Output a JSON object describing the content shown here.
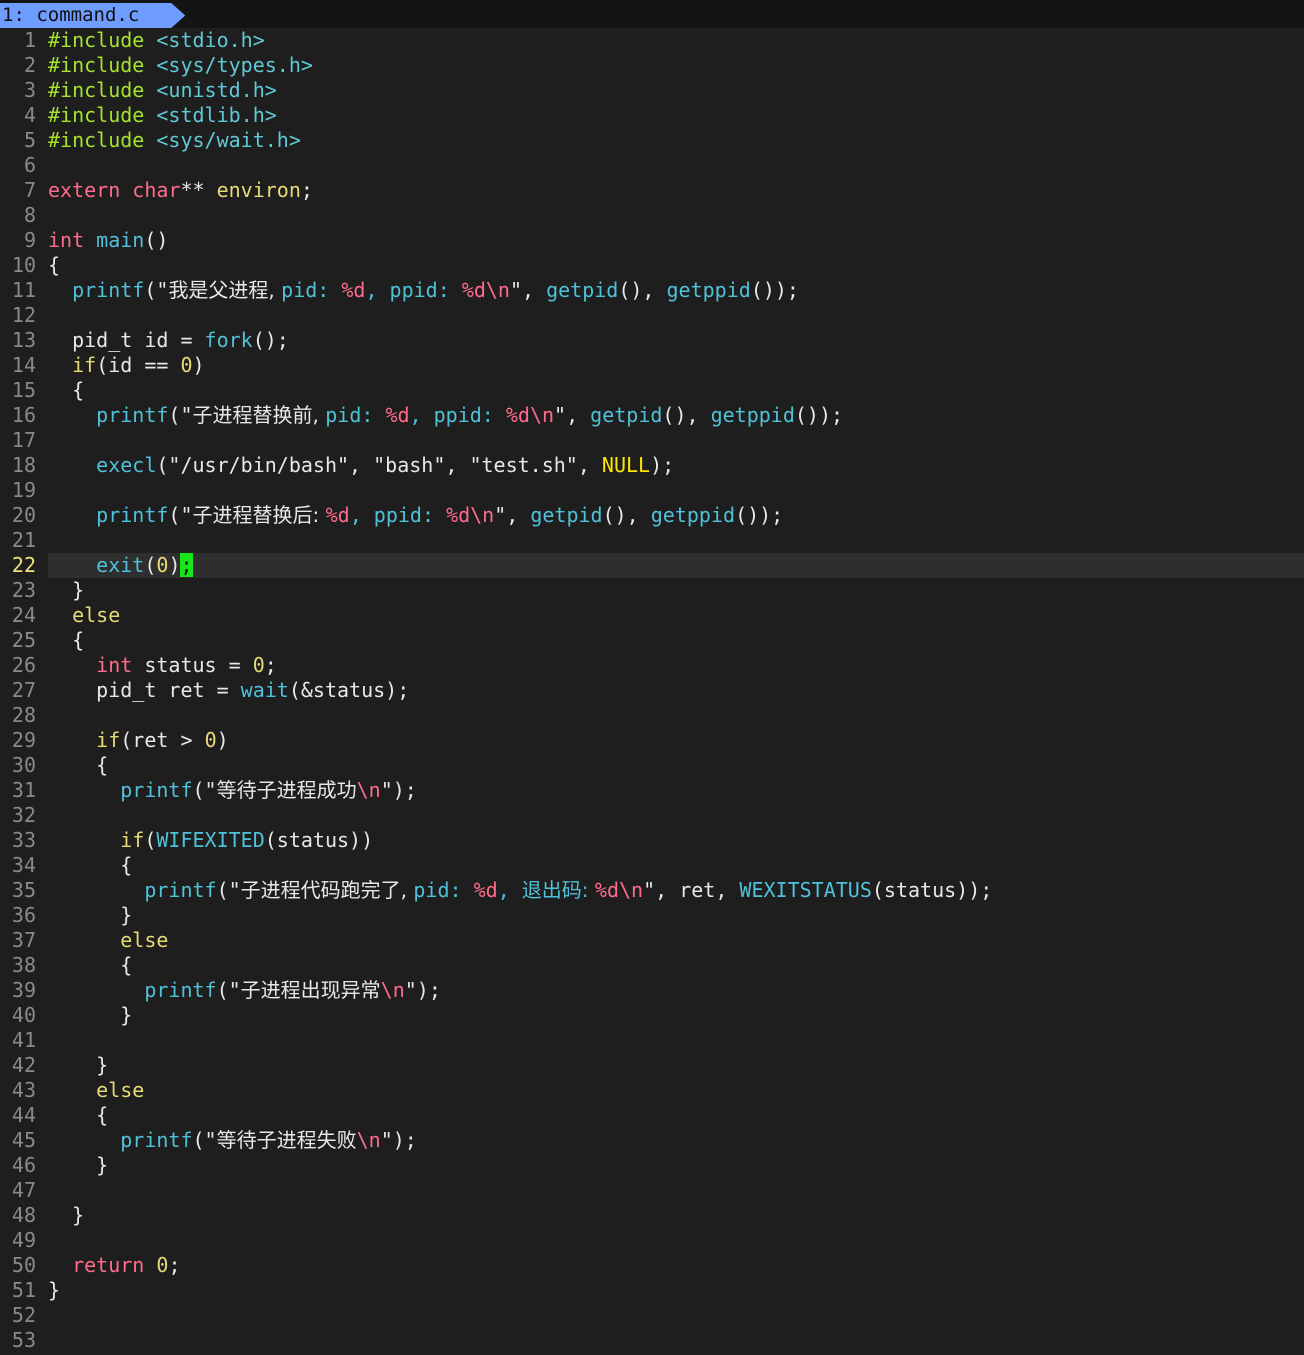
{
  "tabline": {
    "tab_label": "1: command.c"
  },
  "colors": {
    "background": "#1e1e1e",
    "tab": "#6e9dff",
    "keyword_type": "#ff6b8a",
    "keyword_control": "#e6db74",
    "function": "#4fc1d9",
    "preprocessor": "#a6e22e",
    "cursor": "#19e619"
  },
  "editor": {
    "current_line": 22,
    "lines": [
      {
        "n": "1",
        "tokens": [
          [
            "k-pre",
            "#include "
          ],
          [
            "k-inc",
            "<stdio.h>"
          ]
        ]
      },
      {
        "n": "2",
        "tokens": [
          [
            "k-pre",
            "#include "
          ],
          [
            "k-inc",
            "<sys/types.h>"
          ]
        ]
      },
      {
        "n": "3",
        "tokens": [
          [
            "k-pre",
            "#include "
          ],
          [
            "k-inc",
            "<unistd.h>"
          ]
        ]
      },
      {
        "n": "4",
        "tokens": [
          [
            "k-pre",
            "#include "
          ],
          [
            "k-inc",
            "<stdlib.h>"
          ]
        ]
      },
      {
        "n": "5",
        "tokens": [
          [
            "k-pre",
            "#include "
          ],
          [
            "k-inc",
            "<sys/wait.h>"
          ]
        ]
      },
      {
        "n": "6",
        "tokens": []
      },
      {
        "n": "7",
        "tokens": [
          [
            "k-type",
            "extern "
          ],
          [
            "k-type",
            "char"
          ],
          [
            "k-plain",
            "** "
          ],
          [
            "k-ctrl",
            "environ"
          ],
          [
            "k-plain",
            ";"
          ]
        ]
      },
      {
        "n": "8",
        "tokens": []
      },
      {
        "n": "9",
        "tokens": [
          [
            "k-type",
            "int "
          ],
          [
            "k-fn",
            "main"
          ],
          [
            "k-plain",
            "()"
          ]
        ]
      },
      {
        "n": "10",
        "tokens": [
          [
            "k-plain",
            "{"
          ]
        ]
      },
      {
        "n": "11",
        "tokens": [
          [
            "k-plain",
            "  "
          ],
          [
            "k-fn",
            "printf"
          ],
          [
            "k-plain",
            "(\""
          ],
          [
            "k-str k-cjk",
            "我是父进程, "
          ],
          [
            "k-fn",
            "pid: "
          ],
          [
            "k-esc",
            "%d"
          ],
          [
            "k-fn",
            ", ppid: "
          ],
          [
            "k-esc",
            "%d\\n"
          ],
          [
            "k-plain",
            "\", "
          ],
          [
            "k-fn",
            "getpid"
          ],
          [
            "k-plain",
            "(), "
          ],
          [
            "k-fn",
            "getppid"
          ],
          [
            "k-plain",
            "());"
          ]
        ]
      },
      {
        "n": "12",
        "tokens": []
      },
      {
        "n": "13",
        "tokens": [
          [
            "k-plain",
            "  pid_t id = "
          ],
          [
            "k-fn",
            "fork"
          ],
          [
            "k-plain",
            "();"
          ]
        ]
      },
      {
        "n": "14",
        "tokens": [
          [
            "k-plain",
            "  "
          ],
          [
            "k-ctrl",
            "if"
          ],
          [
            "k-plain",
            "(id == "
          ],
          [
            "k-num",
            "0"
          ],
          [
            "k-plain",
            ")"
          ]
        ]
      },
      {
        "n": "15",
        "tokens": [
          [
            "k-plain",
            "  {"
          ]
        ]
      },
      {
        "n": "16",
        "tokens": [
          [
            "k-plain",
            "    "
          ],
          [
            "k-fn",
            "printf"
          ],
          [
            "k-plain",
            "(\""
          ],
          [
            "k-str k-cjk",
            "子进程替换前, "
          ],
          [
            "k-fn",
            "pid: "
          ],
          [
            "k-esc",
            "%d"
          ],
          [
            "k-fn",
            ", ppid: "
          ],
          [
            "k-esc",
            "%d\\n"
          ],
          [
            "k-plain",
            "\", "
          ],
          [
            "k-fn",
            "getpid"
          ],
          [
            "k-plain",
            "(), "
          ],
          [
            "k-fn",
            "getppid"
          ],
          [
            "k-plain",
            "());"
          ]
        ]
      },
      {
        "n": "17",
        "tokens": []
      },
      {
        "n": "18",
        "tokens": [
          [
            "k-plain",
            "    "
          ],
          [
            "k-fn",
            "execl"
          ],
          [
            "k-plain",
            "(\"/usr/bin/bash\", \"bash\", \"test.sh\", "
          ],
          [
            "k-const",
            "NULL"
          ],
          [
            "k-plain",
            ");"
          ]
        ]
      },
      {
        "n": "19",
        "tokens": []
      },
      {
        "n": "20",
        "tokens": [
          [
            "k-plain",
            "    "
          ],
          [
            "k-fn",
            "printf"
          ],
          [
            "k-plain",
            "(\""
          ],
          [
            "k-str k-cjk",
            "子进程替换后: "
          ],
          [
            "k-esc",
            "%d"
          ],
          [
            "k-fn",
            ", ppid: "
          ],
          [
            "k-esc",
            "%d\\n"
          ],
          [
            "k-plain",
            "\", "
          ],
          [
            "k-fn",
            "getpid"
          ],
          [
            "k-plain",
            "(), "
          ],
          [
            "k-fn",
            "getppid"
          ],
          [
            "k-plain",
            "());"
          ]
        ]
      },
      {
        "n": "21",
        "tokens": []
      },
      {
        "n": "22",
        "tokens": [
          [
            "k-plain",
            "    "
          ],
          [
            "k-fn",
            "exit"
          ],
          [
            "k-plain",
            "("
          ],
          [
            "k-num",
            "0"
          ],
          [
            "k-plain",
            ")"
          ],
          [
            "cursor",
            ";"
          ]
        ]
      },
      {
        "n": "23",
        "tokens": [
          [
            "k-plain",
            "  }"
          ]
        ]
      },
      {
        "n": "24",
        "tokens": [
          [
            "k-plain",
            "  "
          ],
          [
            "k-ctrl",
            "else"
          ]
        ]
      },
      {
        "n": "25",
        "tokens": [
          [
            "k-plain",
            "  {"
          ]
        ]
      },
      {
        "n": "26",
        "tokens": [
          [
            "k-plain",
            "    "
          ],
          [
            "k-type",
            "int "
          ],
          [
            "k-plain",
            "status = "
          ],
          [
            "k-num",
            "0"
          ],
          [
            "k-plain",
            ";"
          ]
        ]
      },
      {
        "n": "27",
        "tokens": [
          [
            "k-plain",
            "    pid_t ret = "
          ],
          [
            "k-fn",
            "wait"
          ],
          [
            "k-plain",
            "(&status);"
          ]
        ]
      },
      {
        "n": "28",
        "tokens": []
      },
      {
        "n": "29",
        "tokens": [
          [
            "k-plain",
            "    "
          ],
          [
            "k-ctrl",
            "if"
          ],
          [
            "k-plain",
            "(ret > "
          ],
          [
            "k-num",
            "0"
          ],
          [
            "k-plain",
            ")"
          ]
        ]
      },
      {
        "n": "30",
        "tokens": [
          [
            "k-plain",
            "    {"
          ]
        ]
      },
      {
        "n": "31",
        "tokens": [
          [
            "k-plain",
            "      "
          ],
          [
            "k-fn",
            "printf"
          ],
          [
            "k-plain",
            "(\""
          ],
          [
            "k-str k-cjk",
            "等待子进程成功"
          ],
          [
            "k-esc",
            "\\n"
          ],
          [
            "k-plain",
            "\");"
          ]
        ]
      },
      {
        "n": "32",
        "tokens": []
      },
      {
        "n": "33",
        "tokens": [
          [
            "k-plain",
            "      "
          ],
          [
            "k-ctrl",
            "if"
          ],
          [
            "k-plain",
            "("
          ],
          [
            "k-fn",
            "WIFEXITED"
          ],
          [
            "k-plain",
            "(status))"
          ]
        ]
      },
      {
        "n": "34",
        "tokens": [
          [
            "k-plain",
            "      {"
          ]
        ]
      },
      {
        "n": "35",
        "tokens": [
          [
            "k-plain",
            "        "
          ],
          [
            "k-fn",
            "printf"
          ],
          [
            "k-plain",
            "(\""
          ],
          [
            "k-str k-cjk",
            "子进程代码跑完了, "
          ],
          [
            "k-fn",
            "pid: "
          ],
          [
            "k-esc",
            "%d"
          ],
          [
            "k-fn",
            ", "
          ],
          [
            "k-fn k-cjk",
            "退出码: "
          ],
          [
            "k-esc",
            "%d\\n"
          ],
          [
            "k-plain",
            "\", ret, "
          ],
          [
            "k-fn",
            "WEXITSTATUS"
          ],
          [
            "k-plain",
            "(status));"
          ]
        ]
      },
      {
        "n": "36",
        "tokens": [
          [
            "k-plain",
            "      }"
          ]
        ]
      },
      {
        "n": "37",
        "tokens": [
          [
            "k-plain",
            "      "
          ],
          [
            "k-ctrl",
            "else"
          ]
        ]
      },
      {
        "n": "38",
        "tokens": [
          [
            "k-plain",
            "      {"
          ]
        ]
      },
      {
        "n": "39",
        "tokens": [
          [
            "k-plain",
            "        "
          ],
          [
            "k-fn",
            "printf"
          ],
          [
            "k-plain",
            "(\""
          ],
          [
            "k-str k-cjk",
            "子进程出现异常"
          ],
          [
            "k-esc",
            "\\n"
          ],
          [
            "k-plain",
            "\");"
          ]
        ]
      },
      {
        "n": "40",
        "tokens": [
          [
            "k-plain",
            "      }"
          ]
        ]
      },
      {
        "n": "41",
        "tokens": []
      },
      {
        "n": "42",
        "tokens": [
          [
            "k-plain",
            "    }"
          ]
        ]
      },
      {
        "n": "43",
        "tokens": [
          [
            "k-plain",
            "    "
          ],
          [
            "k-ctrl",
            "else"
          ]
        ]
      },
      {
        "n": "44",
        "tokens": [
          [
            "k-plain",
            "    {"
          ]
        ]
      },
      {
        "n": "45",
        "tokens": [
          [
            "k-plain",
            "      "
          ],
          [
            "k-fn",
            "printf"
          ],
          [
            "k-plain",
            "(\""
          ],
          [
            "k-str k-cjk",
            "等待子进程失败"
          ],
          [
            "k-esc",
            "\\n"
          ],
          [
            "k-plain",
            "\");"
          ]
        ]
      },
      {
        "n": "46",
        "tokens": [
          [
            "k-plain",
            "    }"
          ]
        ]
      },
      {
        "n": "47",
        "tokens": []
      },
      {
        "n": "48",
        "tokens": [
          [
            "k-plain",
            "  }"
          ]
        ]
      },
      {
        "n": "49",
        "tokens": []
      },
      {
        "n": "50",
        "tokens": [
          [
            "k-plain",
            "  "
          ],
          [
            "k-type",
            "return "
          ],
          [
            "k-num",
            "0"
          ],
          [
            "k-plain",
            ";"
          ]
        ]
      },
      {
        "n": "51",
        "tokens": [
          [
            "k-plain",
            "}"
          ]
        ]
      },
      {
        "n": "52",
        "tokens": []
      },
      {
        "n": "53",
        "tokens": []
      }
    ]
  }
}
